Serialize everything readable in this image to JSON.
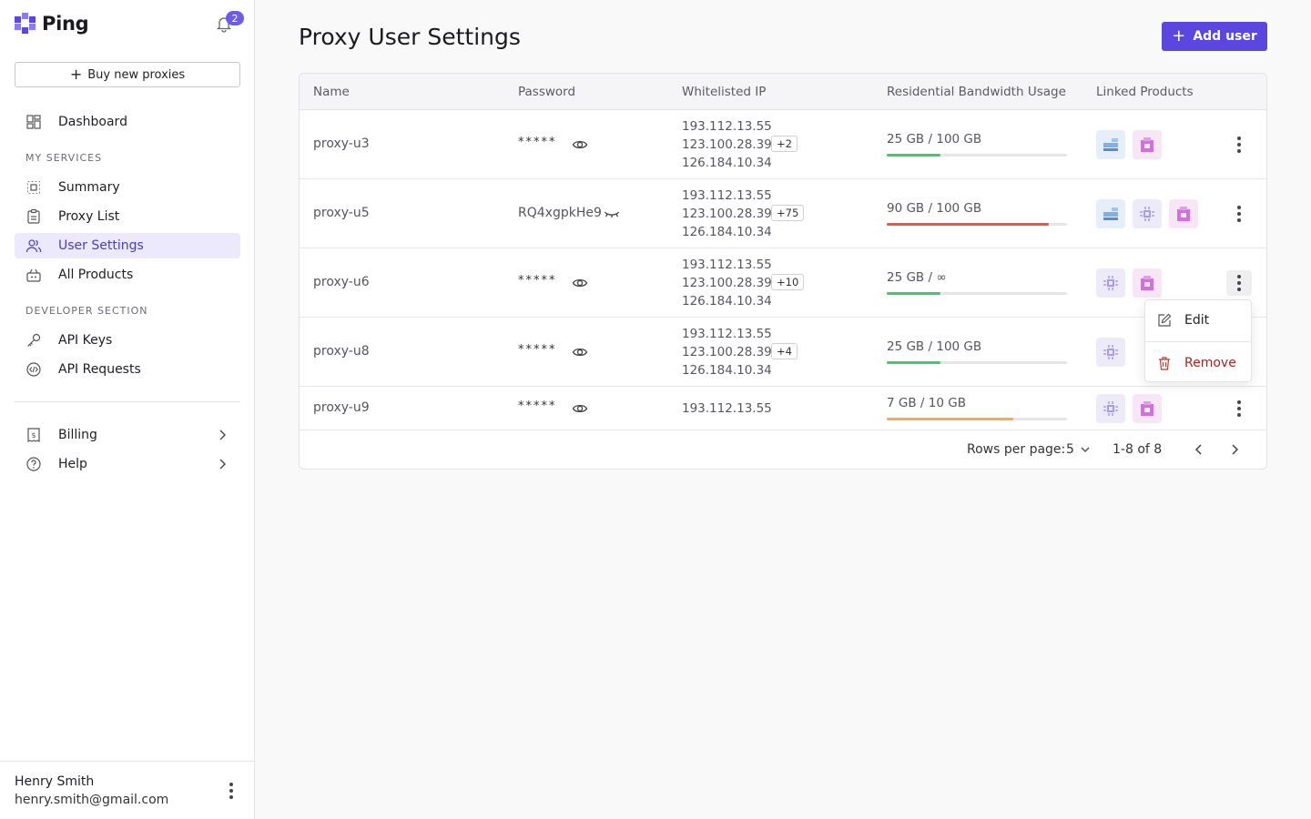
{
  "app": {
    "name": "Ping",
    "notification_count": "2"
  },
  "sidebar": {
    "buy_label": "Buy new proxies",
    "dashboard": "Dashboard",
    "section_services": "MY SERVICES",
    "services": [
      "Summary",
      "Proxy List",
      "User Settings",
      "All Products"
    ],
    "section_developer": "DEVELOPER SECTION",
    "developer": [
      "API Keys",
      "API Requests"
    ],
    "billing": "Billing",
    "help": "Help"
  },
  "user": {
    "name": "Henry Smith",
    "email": "henry.smith@gmail.com"
  },
  "page": {
    "title": "Proxy User Settings",
    "add_user_label": "Add user"
  },
  "table": {
    "columns": [
      "Name",
      "Password",
      "Whitelisted IP",
      "Residential Bandwidth Usage",
      "Linked Products"
    ],
    "rows": [
      {
        "name": "proxy-u3",
        "password": "*****",
        "ips": [
          "193.112.13.55",
          "123.100.28.39",
          "126.184.10.34"
        ],
        "ip_more": "+2",
        "bw_used": "25 GB",
        "bw_sep": "/",
        "bw_total": "100 GB",
        "bw_fraction": 0.3,
        "bw_color": "#3ecb6d",
        "products": [
          "network",
          "box"
        ]
      },
      {
        "name": "proxy-u5",
        "password": "RQ4xgpkHe9",
        "ips": [
          "193.112.13.55",
          "123.100.28.39",
          "126.184.10.34"
        ],
        "ip_more": "+75",
        "bw_used": "90 GB",
        "bw_sep": "/",
        "bw_total": "100 GB",
        "bw_fraction": 0.9,
        "bw_color": "#e9544f",
        "products": [
          "network",
          "chip",
          "box"
        ]
      },
      {
        "name": "proxy-u6",
        "password": "*****",
        "ips": [
          "193.112.13.55",
          "123.100.28.39",
          "126.184.10.34"
        ],
        "ip_more": "+10",
        "bw_used": "25 GB",
        "bw_sep": "/",
        "bw_total": "∞",
        "bw_fraction": 0.3,
        "bw_color": "#3ecb6d",
        "products": [
          "chip",
          "box"
        ]
      },
      {
        "name": "proxy-u8",
        "password": "*****",
        "ips": [
          "193.112.13.55",
          "123.100.28.39",
          "126.184.10.34"
        ],
        "ip_more": "+4",
        "bw_used": "25 GB",
        "bw_sep": "/",
        "bw_total": "100 GB",
        "bw_fraction": 0.3,
        "bw_color": "#3ecb6d",
        "products": [
          "chip"
        ]
      },
      {
        "name": "proxy-u9",
        "password": "*****",
        "ips": [
          "193.112.13.55"
        ],
        "ip_more": "",
        "bw_used": "7 GB",
        "bw_sep": "/",
        "bw_total": "10 GB",
        "bw_fraction": 0.7,
        "bw_color": "#f6ac4c",
        "products": [
          "chip",
          "box"
        ]
      }
    ],
    "footer": {
      "rows_per_page_label": "Rows per page:",
      "rows_per_page": "5",
      "range": "1-8 of 8"
    }
  },
  "context_menu": {
    "edit": "Edit",
    "remove": "Remove"
  }
}
